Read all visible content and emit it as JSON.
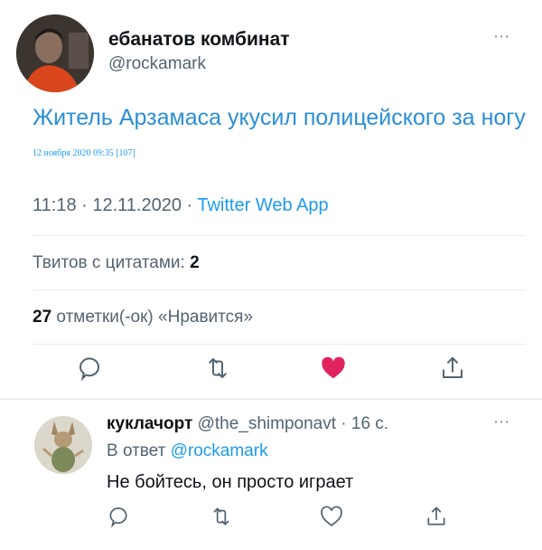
{
  "tweet": {
    "author_name": "ебанатов комбинат",
    "author_handle": "@rockamark",
    "text": "Житель Арзамаса укусил полицейского за ногу",
    "caption": "12 ноября 2020 09:35  [107]",
    "time": "11:18 · 12.11.2020 · ",
    "app": "Twitter Web App",
    "quotes_label": "Твитов с цитатами: ",
    "quotes_count": "2",
    "likes_count": "27",
    "likes_label": " отметки(-ок) «Нравится»",
    "more_icon": "⋯"
  },
  "actions": {
    "reply_icon": "comment-icon",
    "retweet_icon": "retweet-icon",
    "like_icon": "heart-filled-icon",
    "share_icon": "share-icon",
    "like_color": "#e0245e",
    "icon_color": "#536471"
  },
  "reply": {
    "author_name": "куклачорт",
    "author_handle": "@the_shimponavt",
    "age": " · 16 с.",
    "reply_to_label": "В ответ ",
    "reply_to_handle": "@rockamark",
    "text": "Не бойтесь, он просто играет",
    "more_icon": "⋯"
  }
}
